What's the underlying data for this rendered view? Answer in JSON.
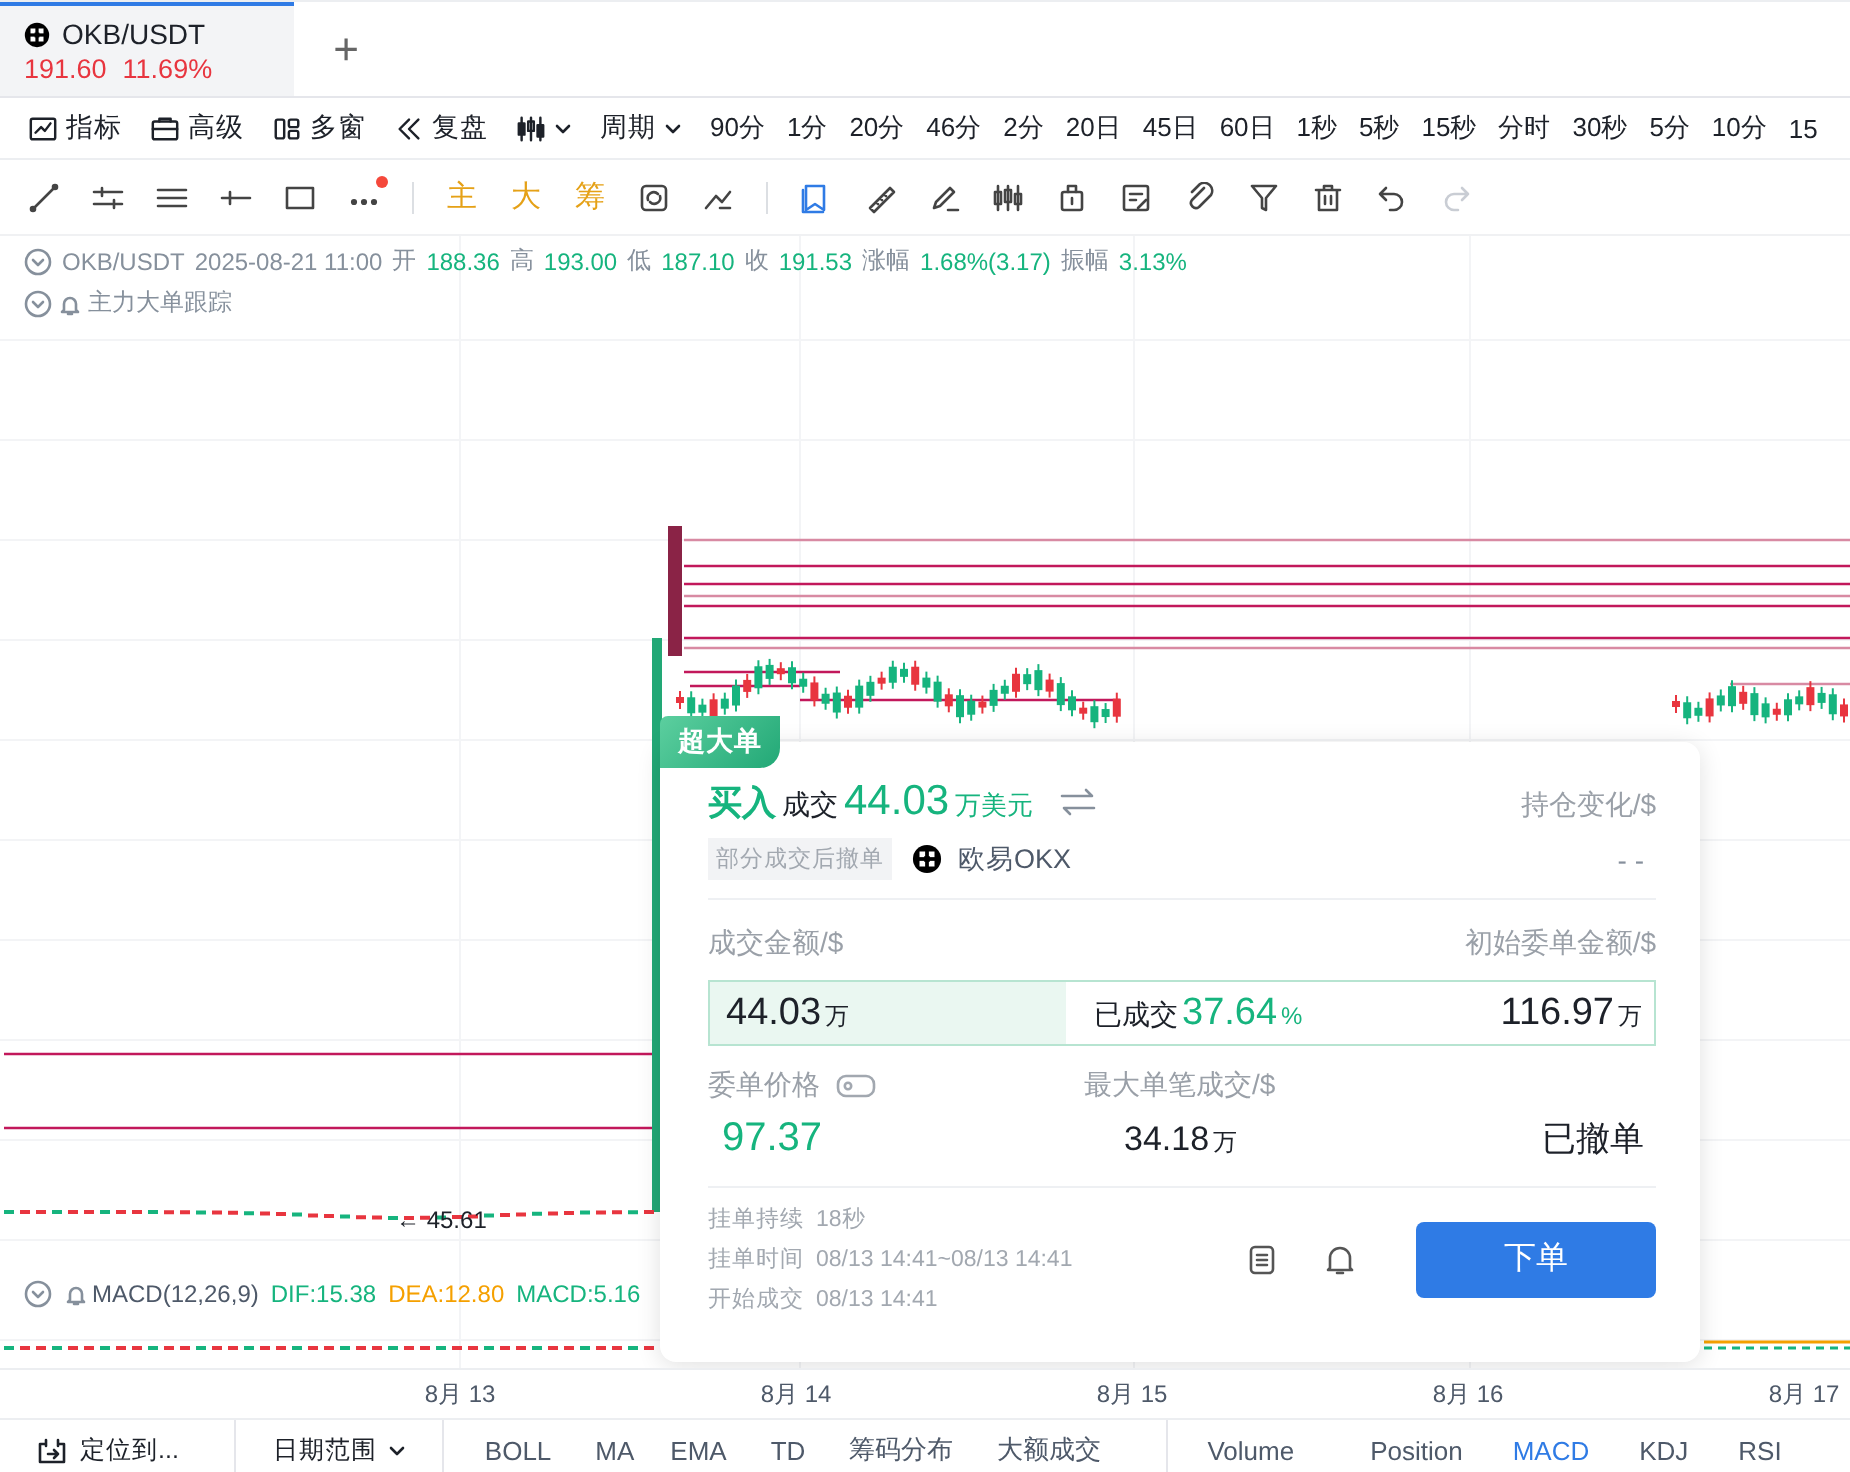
{
  "tabs": [
    {
      "symbol": "OKB/USDT",
      "price": "191.60",
      "change": "11.69%",
      "selected": true
    }
  ],
  "new_tab": "+",
  "toolbar": {
    "tools": [
      "指标",
      "高级",
      "多窗",
      "复盘"
    ],
    "period": "周期",
    "intervals": [
      "90分",
      "1分",
      "20分",
      "46分",
      "2分",
      "20日",
      "45日",
      "60日",
      "1秒",
      "5秒",
      "15秒",
      "分时",
      "30秒",
      "5分",
      "10分",
      "15"
    ]
  },
  "drawing_marks": [
    "主",
    "大",
    "筹"
  ],
  "quote": {
    "symbol": "OKB/USDT",
    "time": "2025-08-21 11:00",
    "fields": [
      {
        "label": "开",
        "value": "188.36"
      },
      {
        "label": "高",
        "value": "193.00"
      },
      {
        "label": "低",
        "value": "187.10"
      },
      {
        "label": "收",
        "value": "191.53"
      },
      {
        "label": "涨幅",
        "value": "1.68%(3.17)"
      },
      {
        "label": "振幅",
        "value": "3.13%"
      }
    ]
  },
  "indicator_title": "主力大单跟踪",
  "price_marker": "← 45.61",
  "macd": {
    "title": "MACD(12,26,9)",
    "values": [
      {
        "text": "DIF:15.38",
        "color": "#16b47e"
      },
      {
        "text": "DEA:12.80",
        "color": "#f5a000"
      },
      {
        "text": "MACD:5.16",
        "color": "#16b47e"
      }
    ]
  },
  "x_labels": [
    "8月 13",
    "8月 14",
    "8月 15",
    "8月 16",
    "8月 17"
  ],
  "order_card": {
    "badge": "超大单",
    "side": "买入",
    "deal_label": "成交",
    "amount": "44.03",
    "amount_unit": "万美元",
    "position_label": "持仓变化/$",
    "position_value": "- -",
    "status_tag": "部分成交后撤单",
    "exchange": "欧易OKX",
    "filled_label": "成交金额/$",
    "initial_label": "初始委单金额/$",
    "filled": "44.03",
    "filled_unit": "万",
    "progress": {
      "label": "已成交",
      "percent": "37.64",
      "percent_unit": "%",
      "level": 0.3764
    },
    "initial": "116.97",
    "initial_unit": "万",
    "price_label": "委单价格",
    "price": "97.37",
    "max_label": "最大单笔成交/$",
    "max": "34.18",
    "max_unit": "万",
    "status": "已撤单",
    "details": [
      {
        "label": "挂单持续",
        "value": "18秒"
      },
      {
        "label": "挂单时间",
        "value": "08/13 14:41~08/13 14:41"
      },
      {
        "label": "开始成交",
        "value": "08/13 14:41"
      }
    ],
    "button": "下单"
  },
  "bottom_bar": {
    "locate": "定位到...",
    "date_range": "日期范围",
    "overlays": [
      "BOLL",
      "MA",
      "EMA",
      "TD",
      "筹码分布",
      "大额成交"
    ],
    "indicators": [
      {
        "label": "Volume",
        "selected": false
      },
      {
        "label": "Position",
        "selected": false
      },
      {
        "label": "MACD",
        "selected": true
      },
      {
        "label": "KDJ",
        "selected": false
      },
      {
        "label": "RSI",
        "selected": false
      }
    ]
  }
}
